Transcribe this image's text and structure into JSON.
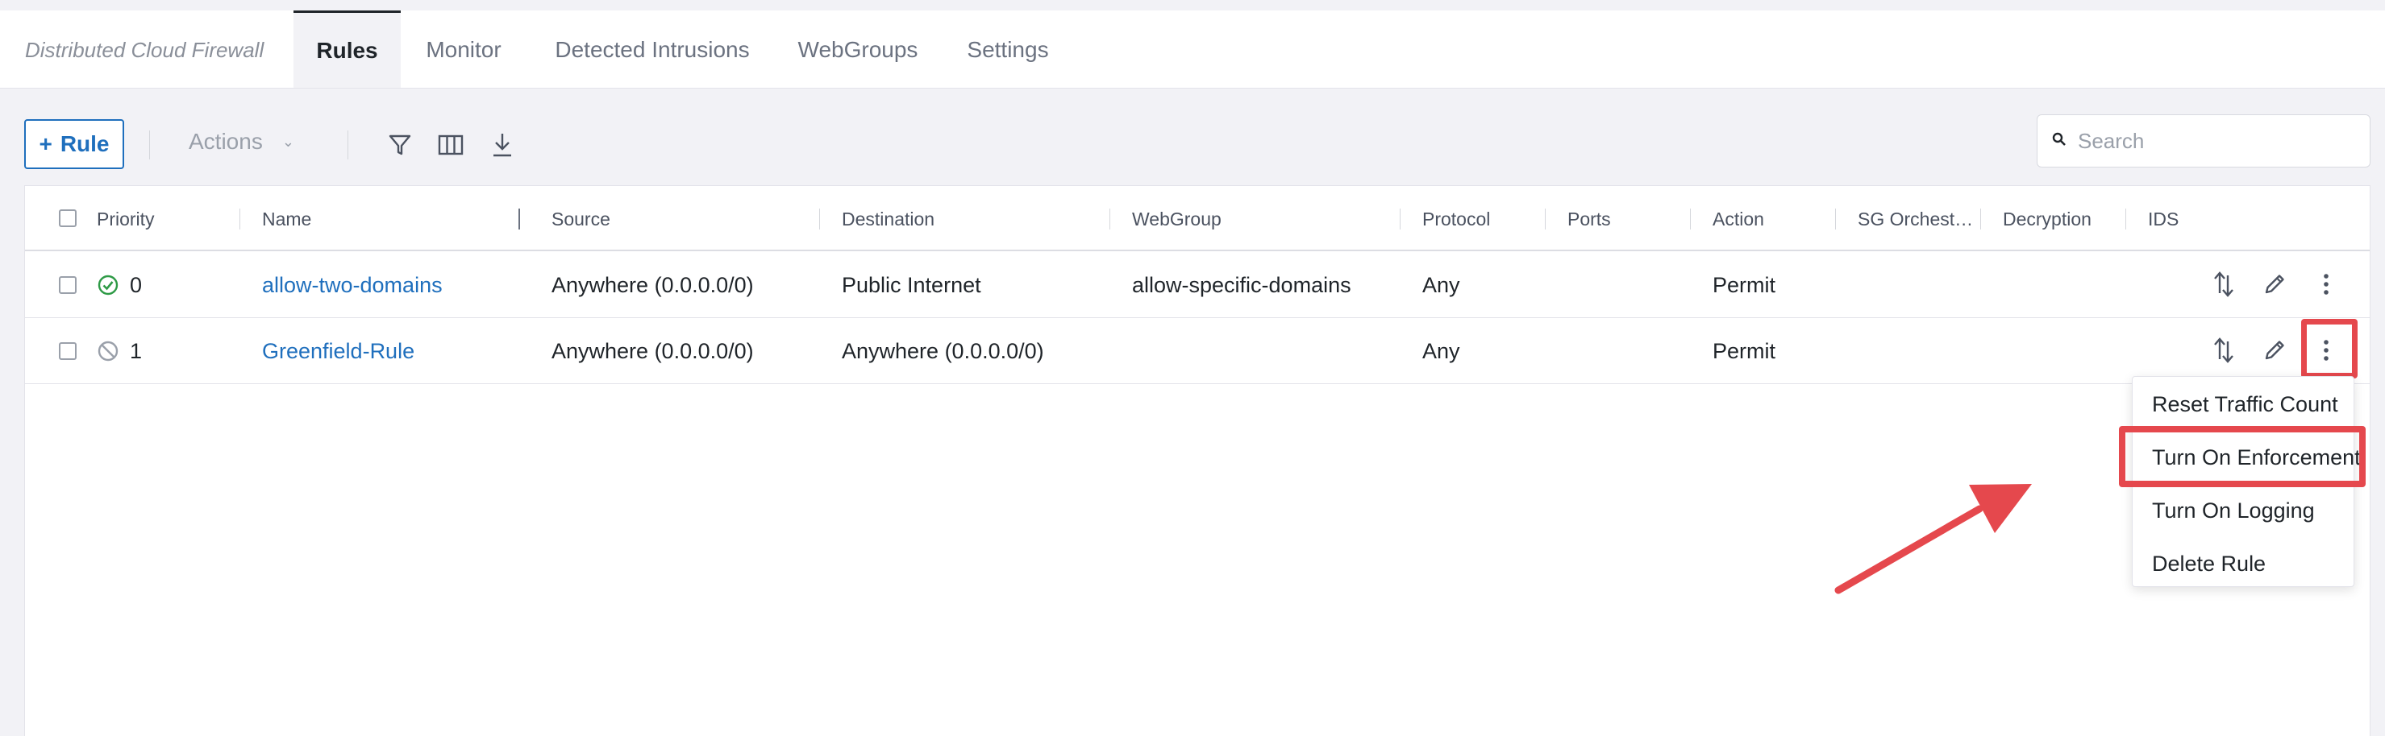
{
  "header": {
    "brand": "Distributed Cloud Firewall",
    "tabs": [
      "Rules",
      "Monitor",
      "Detected Intrusions",
      "WebGroups",
      "Settings"
    ],
    "active_tab": "Rules"
  },
  "toolbar": {
    "add_rule_label": "Rule",
    "actions_label": "Actions",
    "search_placeholder": "Search",
    "icons": [
      "filter-icon",
      "columns-icon",
      "download-icon"
    ]
  },
  "table": {
    "columns": [
      "Priority",
      "Name",
      "Source",
      "Destination",
      "WebGroup",
      "Protocol",
      "Ports",
      "Action",
      "SG Orchest…",
      "Decryption",
      "IDS"
    ],
    "rows": [
      {
        "status": "enforced",
        "priority": "0",
        "name": "allow-two-domains",
        "source": "Anywhere (0.0.0.0/0)",
        "destination": "Public Internet",
        "webgroup": "allow-specific-domains",
        "protocol": "Any",
        "ports": "",
        "action": "Permit"
      },
      {
        "status": "disabled",
        "priority": "1",
        "name": "Greenfield-Rule",
        "source": "Anywhere (0.0.0.0/0)",
        "destination": "Anywhere (0.0.0.0/0)",
        "webgroup": "",
        "protocol": "Any",
        "ports": "",
        "action": "Permit"
      }
    ]
  },
  "context_menu": {
    "items": [
      "Reset Traffic Count",
      "Turn On Enforcement",
      "Turn On Logging",
      "Delete Rule"
    ],
    "highlighted": "Turn On Enforcement"
  },
  "colors": {
    "accent": "#1f6fbd",
    "annotation": "#e5484d",
    "enforced": "#2e9a46"
  }
}
